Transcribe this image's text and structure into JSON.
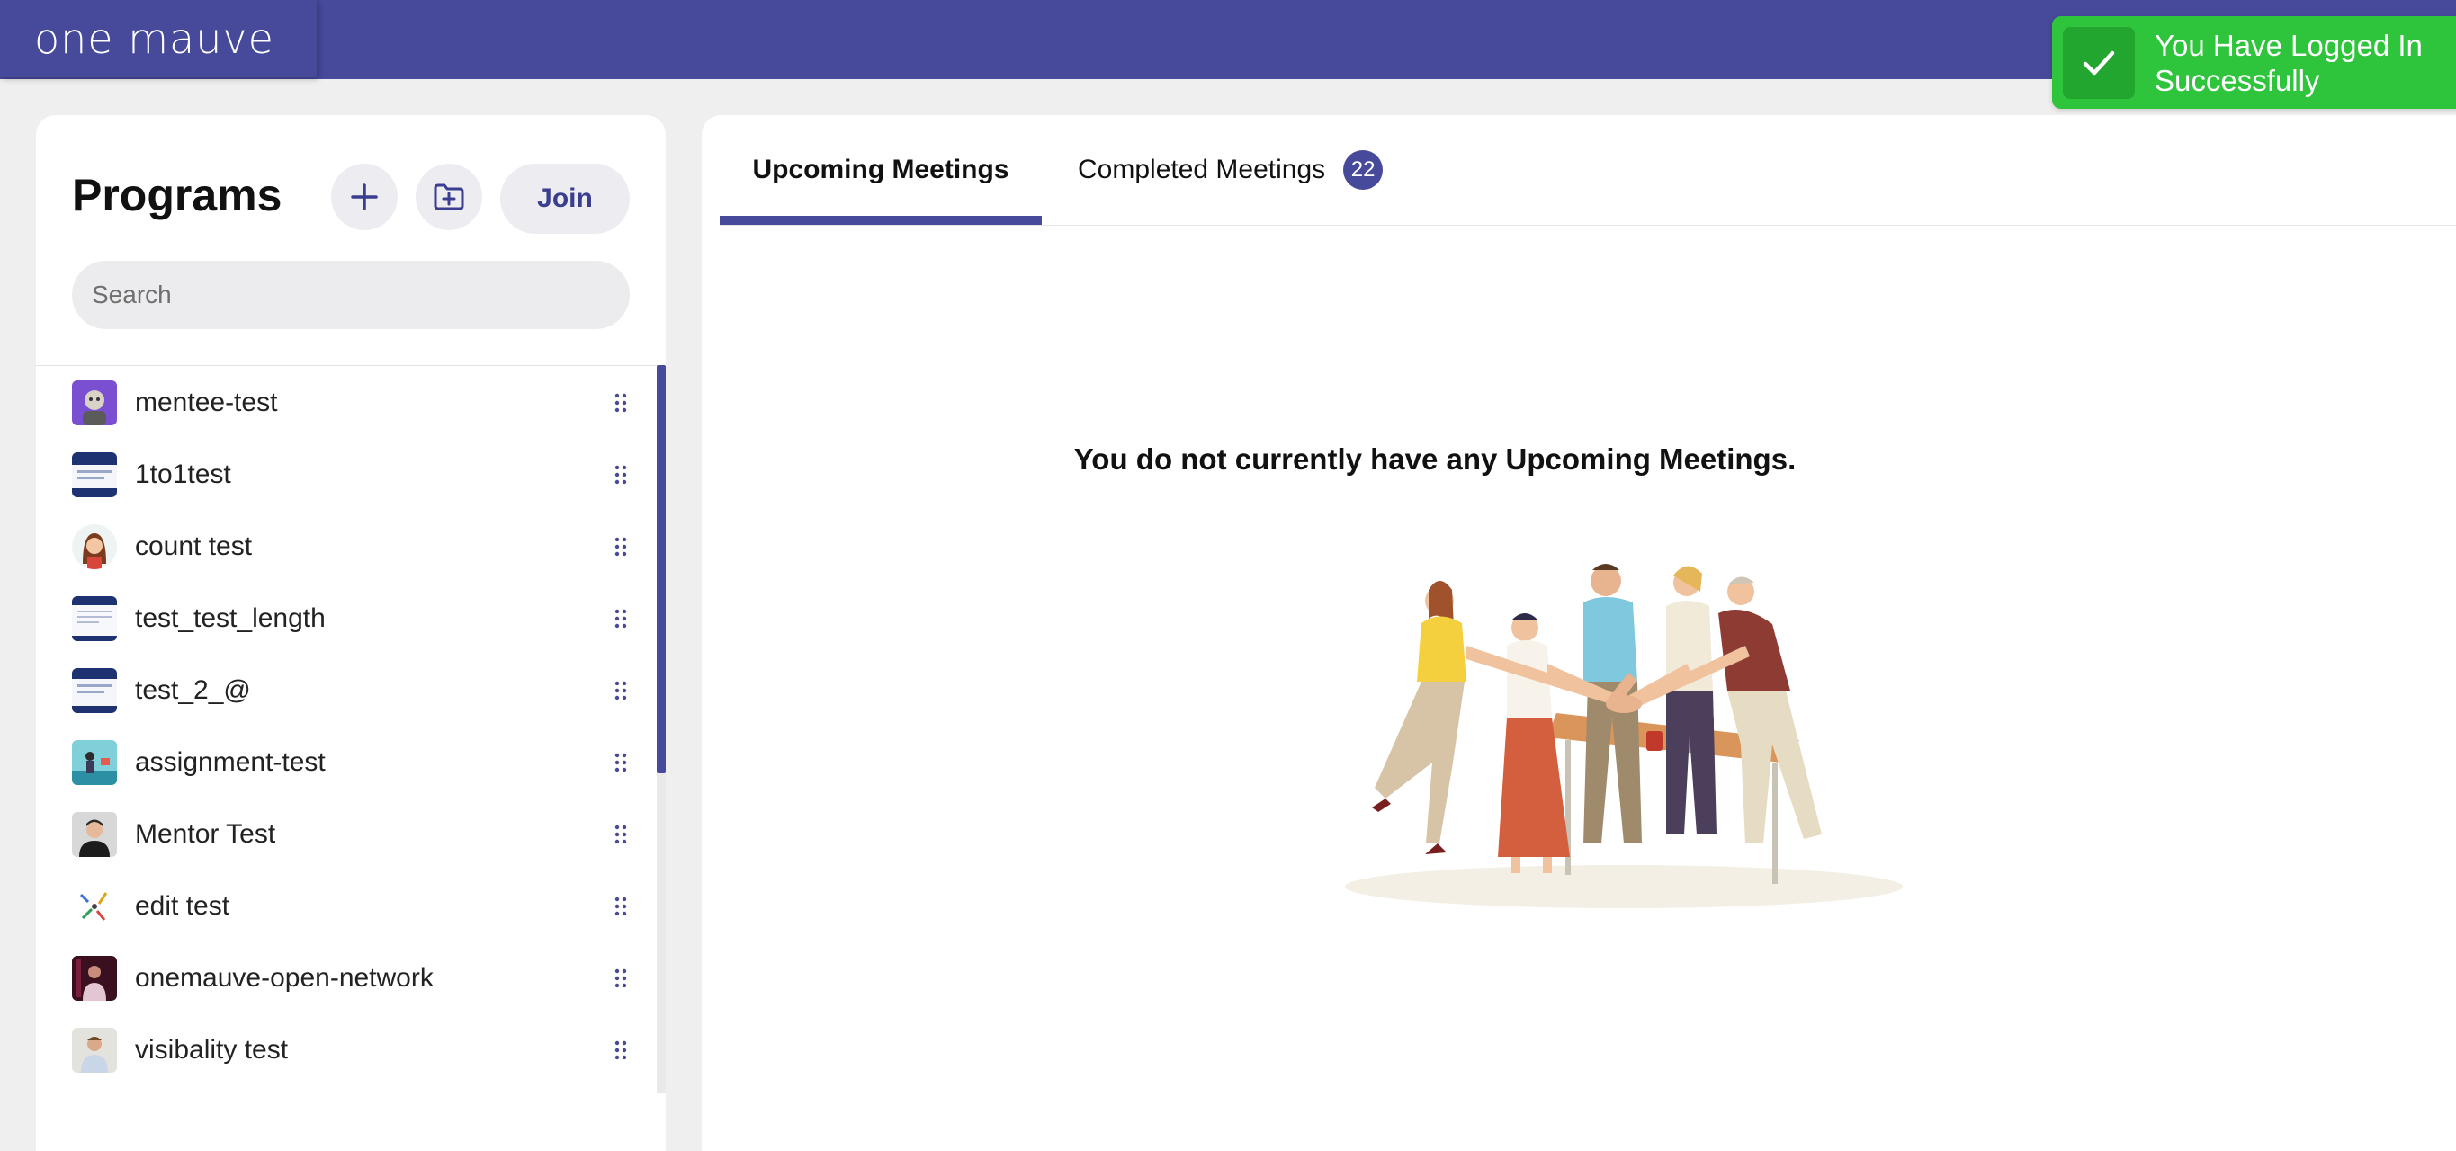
{
  "header": {
    "logo_text": "one mauve"
  },
  "toast": {
    "message": "You Have Logged In Successfully",
    "color": "#2ec43b"
  },
  "sidebar": {
    "title": "Programs",
    "add_icon": "plus-icon",
    "folder_icon": "folder-plus-icon",
    "join_label": "Join",
    "search_placeholder": "Search",
    "items": [
      {
        "label": "mentee-test"
      },
      {
        "label": "1to1test"
      },
      {
        "label": "count test"
      },
      {
        "label": "test_test_length"
      },
      {
        "label": "test_2_@"
      },
      {
        "label": "assignment-test"
      },
      {
        "label": "Mentor Test"
      },
      {
        "label": "edit test"
      },
      {
        "label": "onemauve-open-network"
      },
      {
        "label": "visibality test"
      }
    ]
  },
  "main": {
    "tabs": [
      {
        "label": "Upcoming Meetings",
        "active": true
      },
      {
        "label": "Completed Meetings",
        "count": "22"
      }
    ],
    "empty_message": "You do not currently have any Upcoming Meetings."
  },
  "colors": {
    "brand": "#47499a",
    "success": "#2ec43b"
  }
}
